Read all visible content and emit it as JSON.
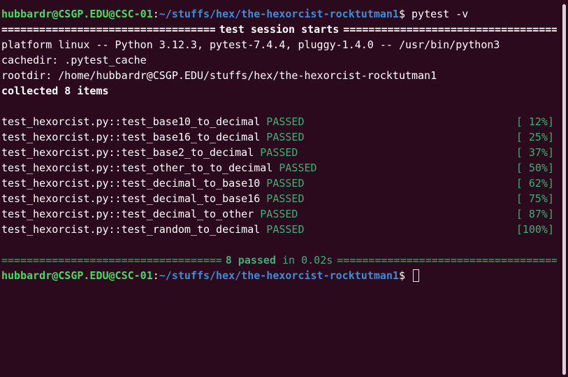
{
  "prompt": {
    "user_host": "hubbardr@CSGP.EDU@CSC-01",
    "separator": ":",
    "path": "~/stuffs/hex/the-hexorcist-rocktutman1",
    "symbol": "$ "
  },
  "command": "pytest -v",
  "session_header": {
    "text": "test session starts",
    "fill": "======================================================================"
  },
  "platform_line": "platform linux -- Python 3.12.3, pytest-7.4.4, pluggy-1.4.0 -- /usr/bin/python3",
  "cachedir_line": "cachedir: .pytest_cache",
  "rootdir_line": "rootdir: /home/hubbardr@CSGP.EDU/stuffs/hex/the-hexorcist-rocktutman1",
  "collected_line": "collected 8 items",
  "tests": [
    {
      "name": "test_hexorcist.py::test_base10_to_decimal",
      "status": "PASSED",
      "percent": "[ 12%]"
    },
    {
      "name": "test_hexorcist.py::test_base16_to_decimal",
      "status": "PASSED",
      "percent": "[ 25%]"
    },
    {
      "name": "test_hexorcist.py::test_base2_to_decimal",
      "status": "PASSED",
      "percent": "[ 37%]"
    },
    {
      "name": "test_hexorcist.py::test_other_to_to_decimal",
      "status": "PASSED",
      "percent": "[ 50%]"
    },
    {
      "name": "test_hexorcist.py::test_decimal_to_base10",
      "status": "PASSED",
      "percent": "[ 62%]"
    },
    {
      "name": "test_hexorcist.py::test_decimal_to_base16",
      "status": "PASSED",
      "percent": "[ 75%]"
    },
    {
      "name": "test_hexorcist.py::test_decimal_to_other",
      "status": "PASSED",
      "percent": "[ 87%]"
    },
    {
      "name": "test_hexorcist.py::test_random_to_decimal",
      "status": "PASSED",
      "percent": "[100%]"
    }
  ],
  "summary": {
    "passed": "8 passed",
    "rest": " in 0.02s",
    "fill": "======================================================================"
  },
  "colors": {
    "background": "#2c0a1e",
    "prompt_user": "#4cd964",
    "prompt_path": "#3f8cd6",
    "passed": "#3fae76"
  }
}
